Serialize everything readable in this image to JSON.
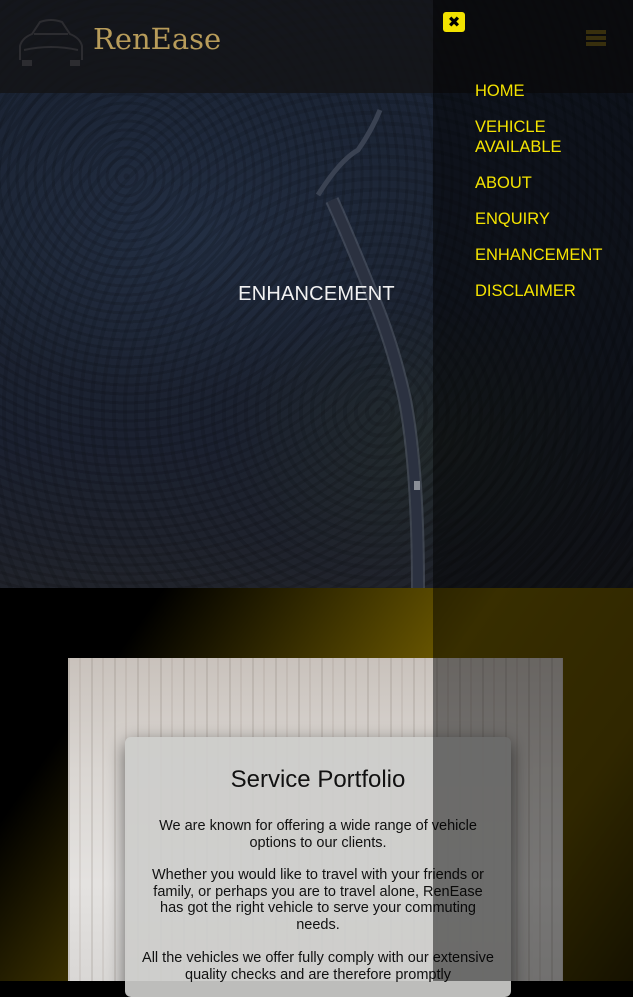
{
  "header": {
    "brand": "RenEase",
    "menu_icon": "hamburger-icon",
    "logo_icon": "car-icon"
  },
  "hero": {
    "title": "ENHANCEMENT"
  },
  "nav": {
    "close_icon": "close-icon",
    "items": [
      {
        "label": "HOME"
      },
      {
        "label": "VEHICLE AVAILABLE"
      },
      {
        "label": "ABOUT"
      },
      {
        "label": "ENQUIRY"
      },
      {
        "label": "ENHANCEMENT"
      },
      {
        "label": "DISCLAIMER"
      }
    ]
  },
  "portfolio": {
    "title": "Service Portfolio",
    "paragraphs": [
      "We are known for offering a wide range of vehicle options to our clients.",
      "Whether you would like to travel with your friends or family, or perhaps you are to travel alone, RenEase has got the right vehicle to serve your commuting needs.",
      "All the vehicles we offer fully comply with our extensive quality checks and are therefore promptly"
    ]
  },
  "colors": {
    "accent": "#f4e300",
    "brand": "#b89c5a",
    "overlay": "#000000"
  }
}
